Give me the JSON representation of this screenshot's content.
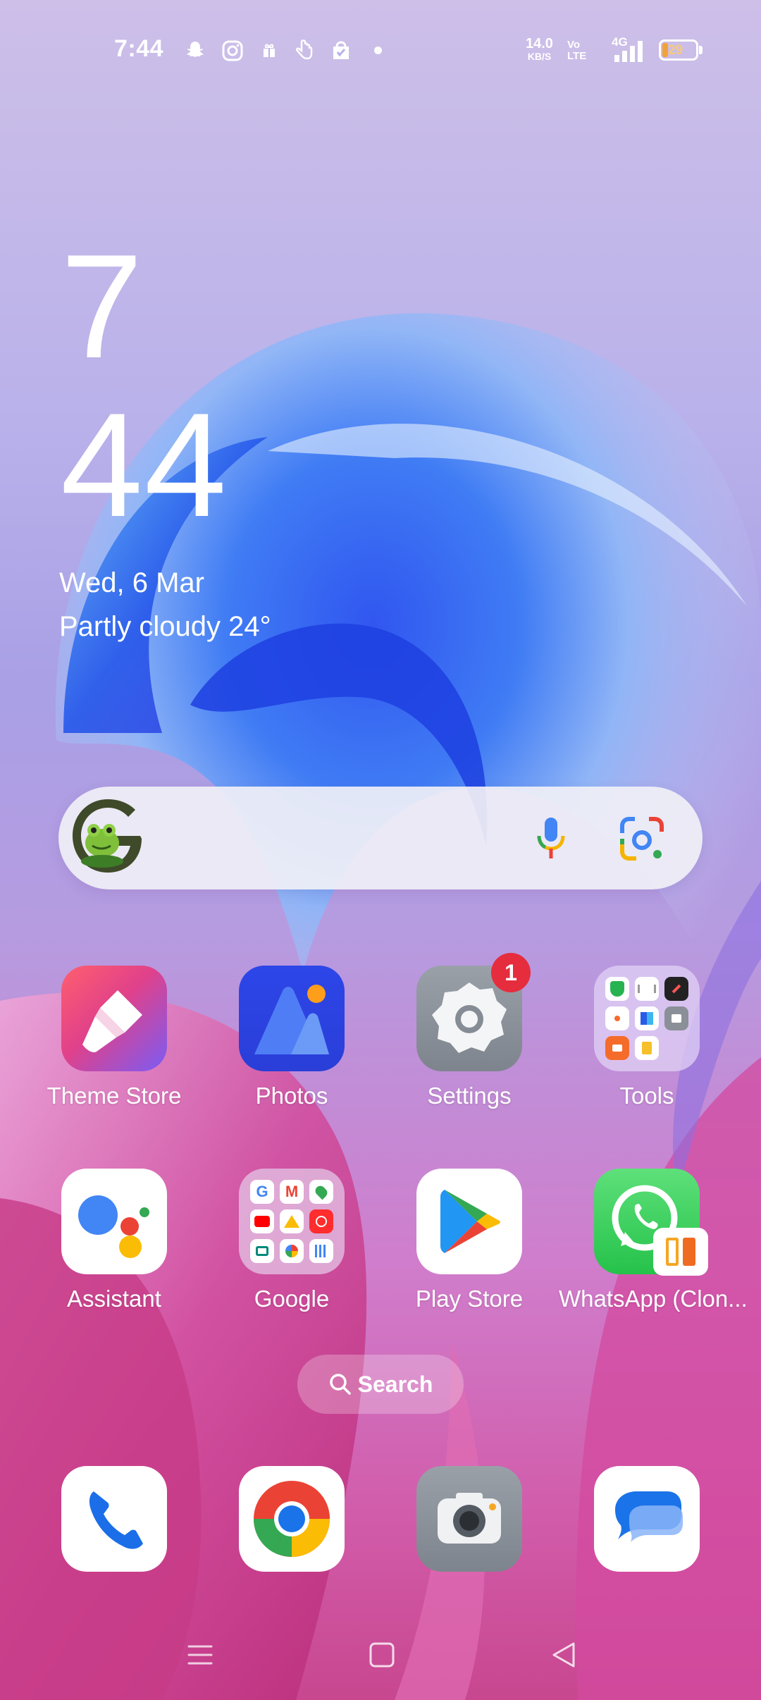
{
  "status_bar": {
    "time": "7:44",
    "net_speed_value": "14.0",
    "net_speed_unit": "KB/S",
    "volte_line1": "Vo",
    "volte_line2": "LTE",
    "network_type": "4G",
    "battery_level": "29",
    "notification_icons": [
      "snapchat-icon",
      "instagram-icon",
      "gift-icon",
      "hand-icon",
      "shopping-bag-icon"
    ]
  },
  "clock_widget": {
    "hour": "7",
    "minute": "44",
    "date": "Wed, 6 Mar",
    "weather": "Partly cloudy  24°"
  },
  "search_bar": {
    "icons": [
      "google-doodle-icon",
      "mic-icon",
      "google-lens-icon"
    ]
  },
  "apps": [
    {
      "label": "Theme Store",
      "icon": "theme-store-icon"
    },
    {
      "label": "Photos",
      "icon": "photos-icon"
    },
    {
      "label": "Settings",
      "icon": "settings-icon",
      "badge": "1"
    },
    {
      "label": "Tools",
      "icon": "tools-folder-icon"
    },
    {
      "label": "Assistant",
      "icon": "assistant-icon"
    },
    {
      "label": "Google",
      "icon": "google-folder-icon"
    },
    {
      "label": "Play Store",
      "icon": "play-store-icon"
    },
    {
      "label": "WhatsApp (Clon...",
      "icon": "whatsapp-clone-icon"
    }
  ],
  "drawer_search": {
    "label": "Search"
  },
  "dock": [
    {
      "icon": "phone-icon"
    },
    {
      "icon": "chrome-icon"
    },
    {
      "icon": "camera-icon"
    },
    {
      "icon": "messages-icon"
    }
  ],
  "nav_bar": [
    "menu-icon",
    "home-icon",
    "back-icon"
  ],
  "colors": {
    "badge": "#e52d3e",
    "whatsapp": "#2ed15c",
    "photos": "#2f4fe0",
    "settings": "#8a8f98"
  }
}
